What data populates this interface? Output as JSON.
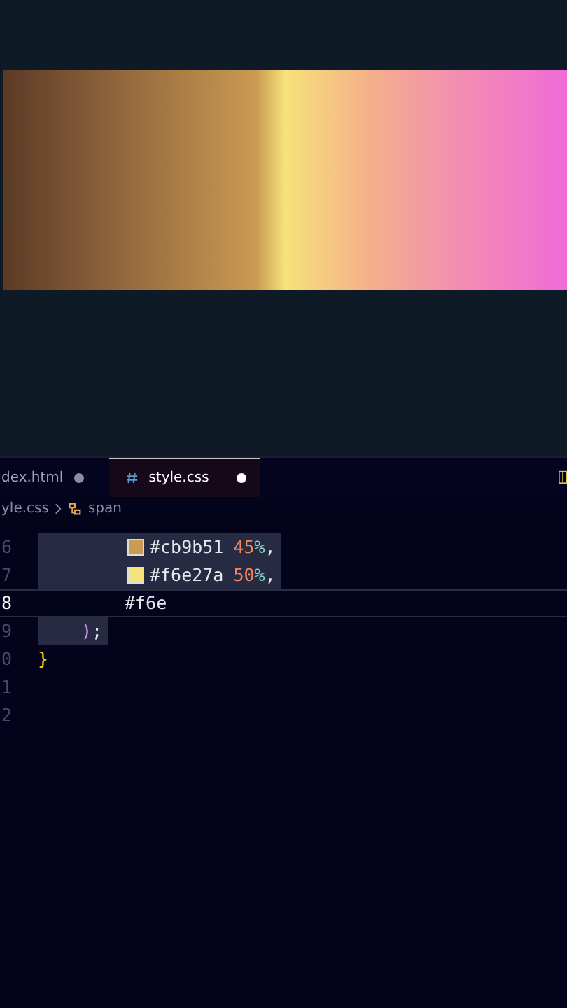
{
  "tabs": [
    {
      "label": "dex.html",
      "selected": false,
      "modified": true,
      "kind": "html"
    },
    {
      "label": "style.css",
      "selected": true,
      "modified": true,
      "kind": "css"
    }
  ],
  "breadcrumb": [
    {
      "label": "yle.css",
      "kind": "file"
    },
    {
      "label": "span",
      "kind": "symbol"
    }
  ],
  "code_lines": [
    {
      "number": "6",
      "kind": "value",
      "current": false,
      "highlighted": true,
      "tokens": [
        {
          "kind": "swatch",
          "color": "#cb9b51"
        },
        {
          "kind": "color",
          "text": "#cb9b51"
        },
        {
          "kind": "number",
          "text": "45"
        },
        {
          "kind": "unit",
          "text": "%"
        },
        {
          "kind": "punct",
          "text": ","
        }
      ]
    },
    {
      "number": "7",
      "kind": "value",
      "current": false,
      "highlighted": true,
      "tokens": [
        {
          "kind": "swatch",
          "color": "#f6e27a"
        },
        {
          "kind": "color",
          "text": "#f6e27a"
        },
        {
          "kind": "number",
          "text": "50"
        },
        {
          "kind": "unit",
          "text": "%"
        },
        {
          "kind": "punct",
          "text": ","
        }
      ]
    },
    {
      "number": "8",
      "kind": "value",
      "current": true,
      "highlighted": false,
      "tokens": [
        {
          "kind": "color",
          "text": "#f6e"
        }
      ]
    },
    {
      "number": "9",
      "kind": "call_end",
      "current": false,
      "highlighted": true,
      "tokens": [
        {
          "kind": "paren",
          "text": ")"
        },
        {
          "kind": "punct",
          "text": ";"
        }
      ]
    },
    {
      "number": "0",
      "kind": "block_end",
      "current": false,
      "highlighted": false,
      "tokens": [
        {
          "kind": "brace",
          "text": "}"
        }
      ]
    },
    {
      "number": "1",
      "kind": "empty",
      "current": false,
      "highlighted": false
    },
    {
      "number": "2",
      "kind": "empty",
      "current": false,
      "highlighted": false
    }
  ]
}
